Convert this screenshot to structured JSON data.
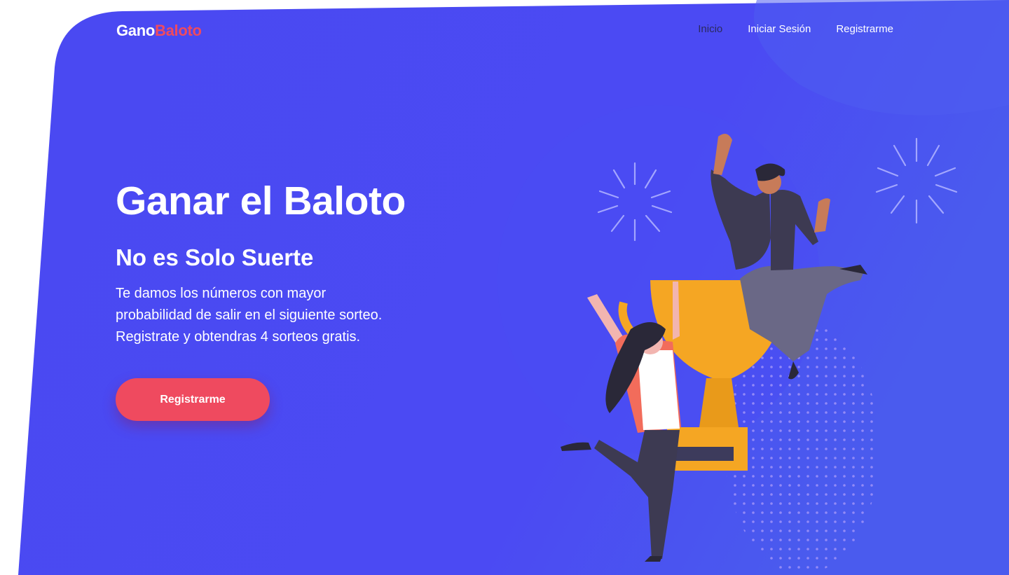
{
  "brand": {
    "name_part1": "Gano",
    "name_part2": "Baloto",
    "colors": {
      "primary": "#4a49f2",
      "accent": "#ef4a5f",
      "trophy": "#f5a623"
    }
  },
  "nav": {
    "items": [
      {
        "label": "Inicio",
        "active": true
      },
      {
        "label": "Iniciar Sesión",
        "active": false
      },
      {
        "label": "Registrarme",
        "active": false
      }
    ]
  },
  "hero": {
    "title": "Ganar el Baloto",
    "subtitle": "No es Solo Suerte",
    "description_lines": [
      "Te damos los números con mayor",
      "probabilidad de salir en el siguiente sorteo.",
      "Registrate y obtendras 4 sorteos gratis."
    ],
    "cta_label": "Registrarme"
  },
  "illustration": {
    "icons": [
      "fireworks-icon",
      "trophy-icon",
      "celebrating-woman-icon",
      "celebrating-man-icon"
    ]
  }
}
